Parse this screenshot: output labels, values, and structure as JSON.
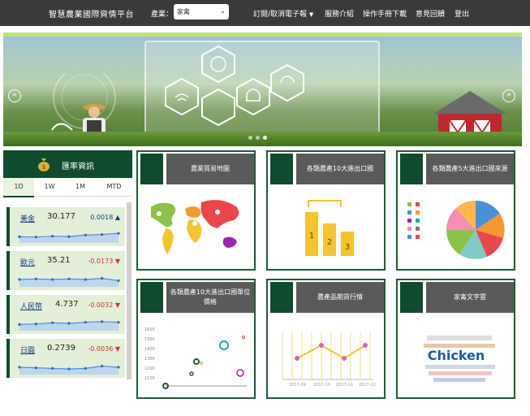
{
  "header": {
    "brand": "智慧農業國際資情平台",
    "product_label": "產業：",
    "product_value": "家禽",
    "nav": [
      {
        "label": "訂閱/取消電子報",
        "dropdown": true
      },
      {
        "label": "服務介紹"
      },
      {
        "label": "操作手冊下載"
      },
      {
        "label": "意見回饋"
      },
      {
        "label": "登出"
      }
    ]
  },
  "banner": {
    "prev_icon": "«",
    "next_icon": "»"
  },
  "sidebar": {
    "title": "匯率資訊",
    "tabs": [
      "1D",
      "1W",
      "1M",
      "MTD"
    ],
    "active_tab": "1D",
    "rates": [
      {
        "name": "美金",
        "value": "30.177",
        "change": "0.0018",
        "direction": "up",
        "trend": [
          0.4,
          0.38,
          0.45,
          0.42,
          0.55,
          0.6,
          0.7
        ]
      },
      {
        "name": "歐元",
        "value": "35.21",
        "change": "-0.0173",
        "direction": "down",
        "trend": [
          0.5,
          0.55,
          0.5,
          0.55,
          0.5,
          0.6,
          0.4
        ]
      },
      {
        "name": "人民幣",
        "value": "4.737",
        "change": "-0.0032",
        "direction": "down",
        "trend": [
          0.4,
          0.45,
          0.55,
          0.5,
          0.6,
          0.65,
          0.6
        ]
      },
      {
        "name": "日圓",
        "value": "0.2739",
        "change": "-0.0036",
        "direction": "down",
        "trend": [
          0.5,
          0.45,
          0.4,
          0.35,
          0.4,
          0.6,
          0.5
        ]
      }
    ]
  },
  "cards": [
    {
      "title": "農業貿易地圖"
    },
    {
      "title": "各類農產10大進出口國"
    },
    {
      "title": "各類農產5大進出口國來源"
    },
    {
      "title": "各類農產10大進出口國單位價格"
    },
    {
      "title": "農產品期貨行情"
    },
    {
      "title": "家禽文字雲"
    }
  ],
  "card_images": {
    "podium_labels": [
      "1",
      "2",
      "3"
    ],
    "scatter_ticks": [
      "1600",
      "1500",
      "1400",
      "1300",
      "1200",
      "1100"
    ],
    "futures_ticks": [
      "2017-09",
      "2017-10",
      "2017-11",
      "2017-12"
    ],
    "wordcloud_word": "Chicken"
  },
  "colors": {
    "topbar": "#3a3a3a",
    "accent": "#0f4b2c",
    "card_border": "#1f5c35",
    "card_title_bg": "#5a5a5a",
    "up": "#1b3a7a",
    "down": "#d03030"
  }
}
